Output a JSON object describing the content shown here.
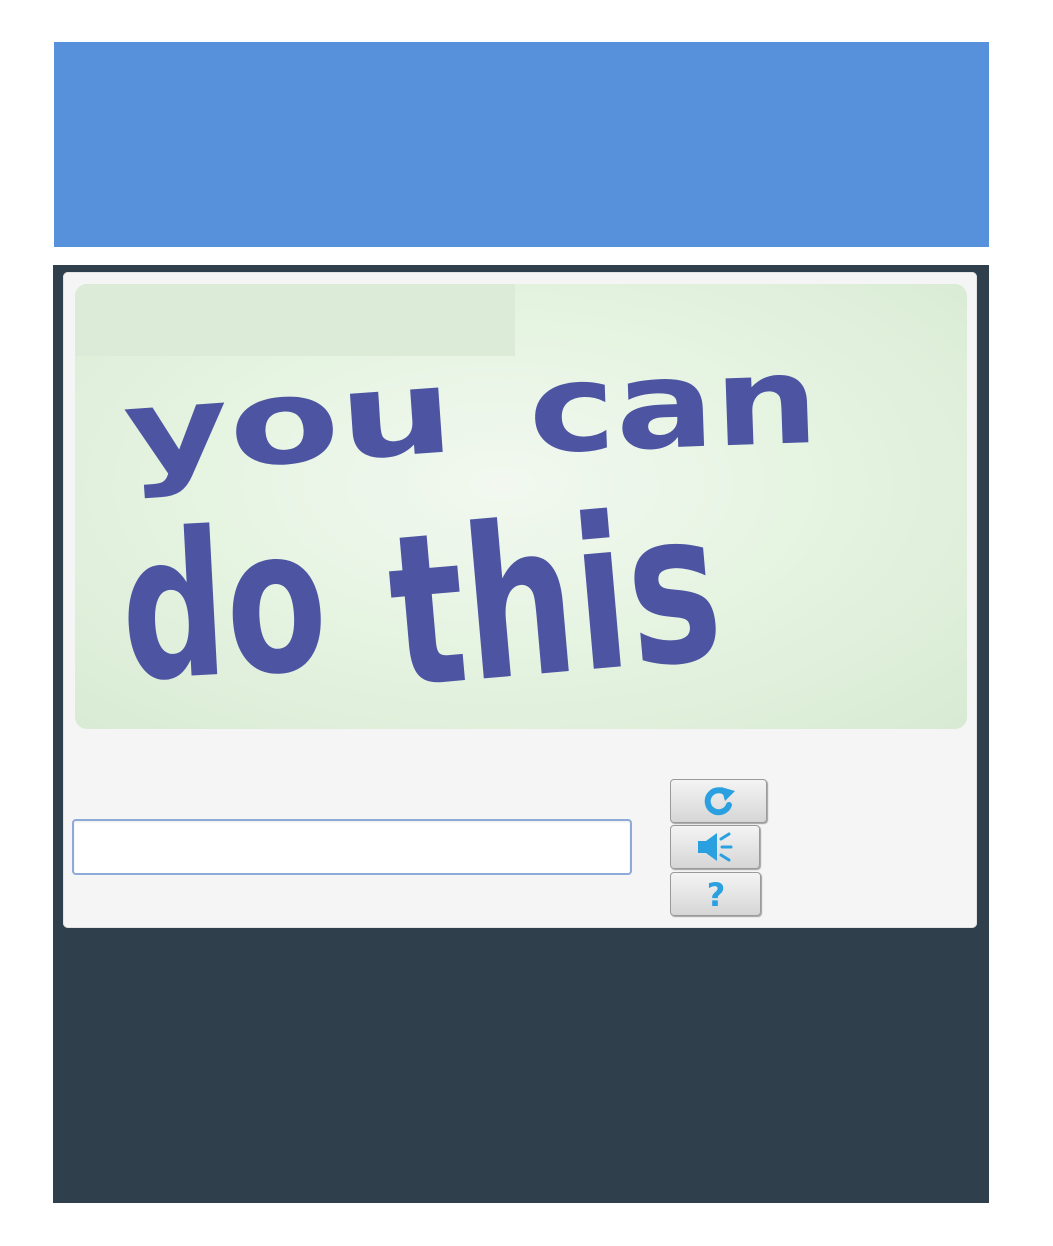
{
  "captcha": {
    "challenge_words": [
      "you",
      "can",
      "do",
      "this"
    ],
    "text_color": "#4d55a3",
    "answer_value": "",
    "buttons": [
      {
        "action": "refresh",
        "icon": "refresh-icon"
      },
      {
        "action": "audio",
        "icon": "speaker-icon"
      },
      {
        "action": "help",
        "icon": "help-icon",
        "glyph": "?"
      }
    ]
  },
  "colors": {
    "header_band": "#5891db",
    "panel_background": "#2f3f4c",
    "card_background": "#f5f5f5",
    "icon_accent": "#2aa0e0"
  }
}
